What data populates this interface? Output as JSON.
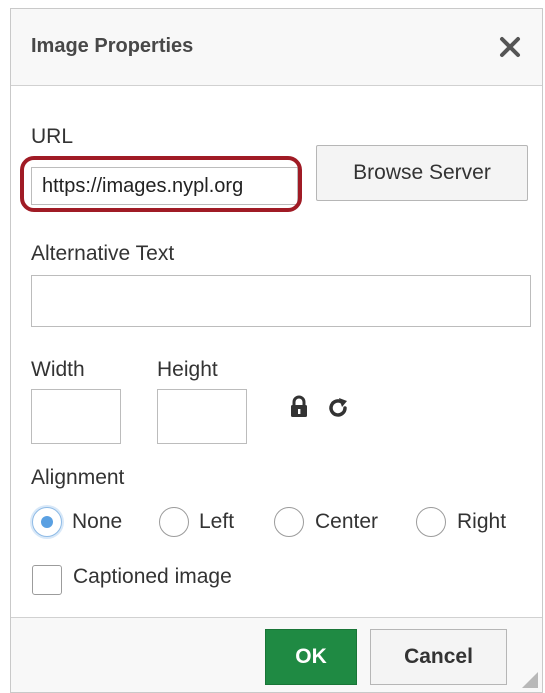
{
  "dialog": {
    "title": "Image Properties"
  },
  "url": {
    "label": "URL",
    "value": "https://images.nypl.org",
    "browse_label": "Browse Server"
  },
  "alt_text": {
    "label": "Alternative Text",
    "value": ""
  },
  "size": {
    "width_label": "Width",
    "height_label": "Height",
    "width_value": "",
    "height_value": ""
  },
  "alignment": {
    "label": "Alignment",
    "options": [
      "None",
      "Left",
      "Center",
      "Right"
    ],
    "selected": "None"
  },
  "caption": {
    "label": "Captioned image",
    "checked": false
  },
  "footer": {
    "ok_label": "OK",
    "cancel_label": "Cancel"
  },
  "colors": {
    "ok_green": "#1f8a43",
    "highlight_red": "#a01b25",
    "radio_blue": "#5aa0e2"
  }
}
